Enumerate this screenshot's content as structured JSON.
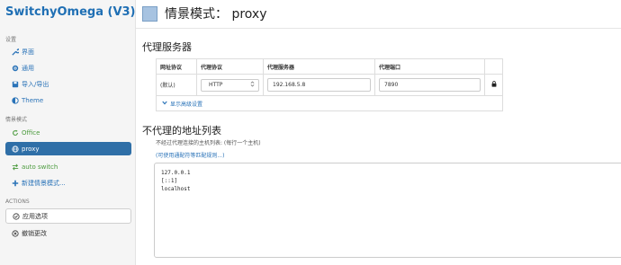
{
  "app": {
    "title": "SwitchyOmega (V3)"
  },
  "sidebar": {
    "settings_label": "设置",
    "settings_items": [
      {
        "label": "界面",
        "icon": "wrench-icon"
      },
      {
        "label": "通用",
        "icon": "gear-icon"
      },
      {
        "label": "导入/导出",
        "icon": "floppy-icon"
      },
      {
        "label": "Theme",
        "icon": "half-circle-icon"
      }
    ],
    "profiles_label": "情景模式",
    "profiles": [
      {
        "label": "Office",
        "icon": "refresh-icon",
        "color": "#4a9a3c"
      },
      {
        "label": "proxy",
        "icon": "globe-icon",
        "color": "#2f6fa7",
        "active": true
      },
      {
        "label": "auto switch",
        "icon": "switch-icon",
        "color": "#4a9a3c"
      },
      {
        "label": "新建情景模式...",
        "icon": "plus-icon"
      }
    ],
    "actions_label": "ACTIONS",
    "apply_label": "应用选项",
    "discard_label": "撤销更改"
  },
  "page": {
    "title": "情景模式： proxy",
    "swatch_color": "#a7c3e1"
  },
  "proxy_servers": {
    "heading": "代理服务器",
    "headers": [
      "网址协议",
      "代理协议",
      "代理服务器",
      "代理端口"
    ],
    "row": {
      "scheme": "(默认)",
      "protocol": "HTTP",
      "server": "192.168.5.8",
      "port": "7890"
    },
    "advanced_label": "显示高级设置"
  },
  "bypass": {
    "heading": "不代理的地址列表",
    "description": "不经过代理连接的主机列表: (每行一个主机)",
    "wildcard_link": "(可使用通配符等匹配规则...)",
    "lines": [
      "127.0.0.1",
      "[::1]",
      "localhost"
    ]
  }
}
